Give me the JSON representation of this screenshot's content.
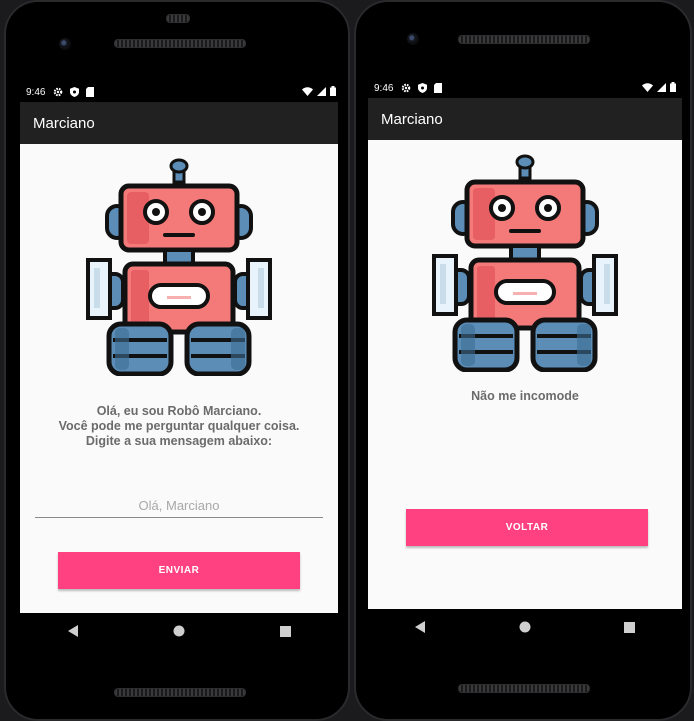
{
  "status": {
    "time": "9:46"
  },
  "screen1": {
    "app_title": "Marciano",
    "message_line1": "Olá, eu sou Robô Marciano.",
    "message_line2": "Você pode me perguntar qualquer coisa.",
    "message_line3": "Digite a sua mensagem abaixo:",
    "input_placeholder": "Olá, Marciano",
    "send_button": "ENVIAR"
  },
  "screen2": {
    "app_title": "Marciano",
    "message": "Não me incomode",
    "back_button": "VOLTAR"
  },
  "colors": {
    "accent": "#ff4081",
    "appbar": "#212121",
    "robot_red": "#f47a7a",
    "robot_blue": "#4f7fa8"
  }
}
